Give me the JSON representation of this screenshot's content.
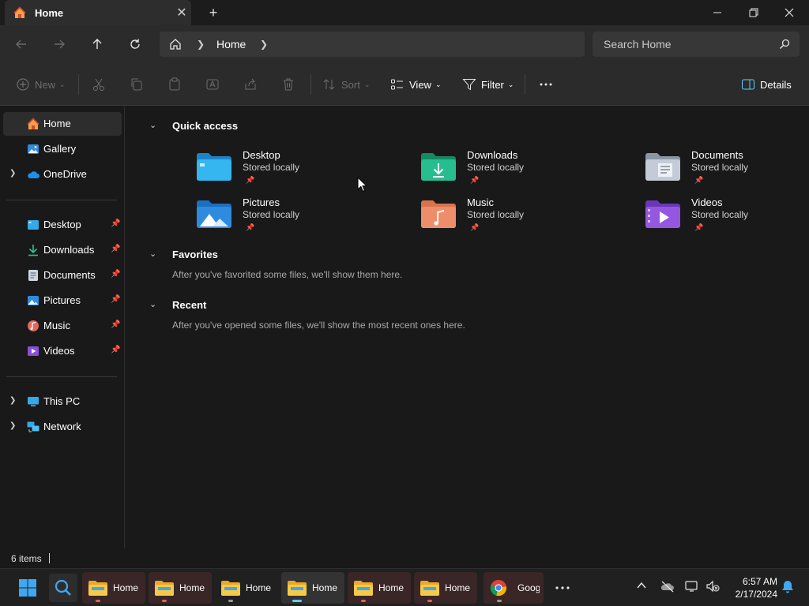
{
  "window": {
    "tab_title": "Home",
    "colors": {
      "accent": "#60cdff",
      "background": "#191919",
      "chrome": "#2b2b2b"
    }
  },
  "navbar": {
    "breadcrumb": "Home",
    "search_placeholder": "Search Home"
  },
  "commandbar": {
    "new_label": "New",
    "sort_label": "Sort",
    "view_label": "View",
    "filter_label": "Filter",
    "details_label": "Details"
  },
  "sidebar": {
    "top": [
      {
        "label": "Home",
        "icon": "home-icon"
      },
      {
        "label": "Gallery",
        "icon": "gallery-icon"
      },
      {
        "label": "OneDrive",
        "icon": "onedrive-icon"
      }
    ],
    "pinned": [
      {
        "label": "Desktop",
        "icon": "desktop-folder-icon"
      },
      {
        "label": "Downloads",
        "icon": "downloads-icon"
      },
      {
        "label": "Documents",
        "icon": "documents-icon"
      },
      {
        "label": "Pictures",
        "icon": "pictures-icon"
      },
      {
        "label": "Music",
        "icon": "music-icon"
      },
      {
        "label": "Videos",
        "icon": "videos-icon"
      }
    ],
    "bottom": [
      {
        "label": "This PC",
        "icon": "this-pc-icon"
      },
      {
        "label": "Network",
        "icon": "network-icon"
      }
    ]
  },
  "main": {
    "quick_access": {
      "title": "Quick access",
      "items": [
        {
          "name": "Desktop",
          "sub": "Stored locally"
        },
        {
          "name": "Downloads",
          "sub": "Stored locally"
        },
        {
          "name": "Documents",
          "sub": "Stored locally"
        },
        {
          "name": "Pictures",
          "sub": "Stored locally"
        },
        {
          "name": "Music",
          "sub": "Stored locally"
        },
        {
          "name": "Videos",
          "sub": "Stored locally"
        }
      ]
    },
    "favorites": {
      "title": "Favorites",
      "message": "After you've favorited some files, we'll show them here."
    },
    "recent": {
      "title": "Recent",
      "message": "After you've opened some files, we'll show the most recent ones here."
    }
  },
  "status": {
    "count": "6 items"
  },
  "taskbar": {
    "apps": [
      {
        "label": "Home"
      },
      {
        "label": "Home"
      },
      {
        "label": "Home"
      },
      {
        "label": "Home"
      },
      {
        "label": "Home"
      },
      {
        "label": "Home"
      },
      {
        "label": "Goog"
      }
    ],
    "time": "6:57 AM",
    "date": "2/17/2024"
  }
}
